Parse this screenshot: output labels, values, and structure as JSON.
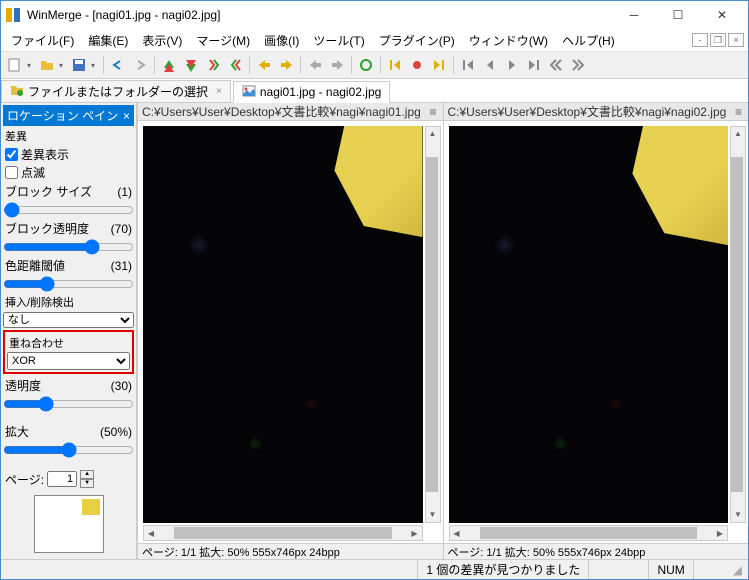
{
  "window": {
    "title": "WinMerge - [nagi01.jpg - nagi02.jpg]"
  },
  "menu": {
    "file": "ファイル(F)",
    "edit": "編集(E)",
    "view": "表示(V)",
    "merge": "マージ(M)",
    "image": "画像(I)",
    "tool": "ツール(T)",
    "plugin": "プラグイン(P)",
    "window": "ウィンドウ(W)",
    "help": "ヘルプ(H)"
  },
  "tabs": {
    "t1": "ファイルまたはフォルダーの選択",
    "t2": "nagi01.jpg - nagi02.jpg"
  },
  "sidebar": {
    "title": "ロケーション ペイン",
    "diff_section": "差異",
    "show_diff": "差異表示",
    "blink": "点滅",
    "block_size": "ブロック サイズ",
    "block_size_val": "(1)",
    "block_alpha": "ブロック透明度",
    "block_alpha_val": "(70)",
    "color_dist": "色距離閾値",
    "color_dist_val": "(31)",
    "ins_del": "挿入/削除検出",
    "ins_del_sel": "なし",
    "overlay": "重ね合わせ",
    "overlay_sel": "XOR",
    "alpha": "透明度",
    "alpha_val": "(30)",
    "zoom": "拡大",
    "zoom_val": "(50%)",
    "page_label": "ページ:",
    "page_val": "1"
  },
  "panes": {
    "left_path": "C:¥Users¥User¥Desktop¥文書比較¥nagi¥nagi01.jpg",
    "right_path": "C:¥Users¥User¥Desktop¥文書比較¥nagi¥nagi02.jpg",
    "status": "ページ: 1/1  拡大: 50%  555x746px  24bpp"
  },
  "statusbar": {
    "diff_found": "1 個の差異が見つかりました",
    "num": "NUM"
  }
}
